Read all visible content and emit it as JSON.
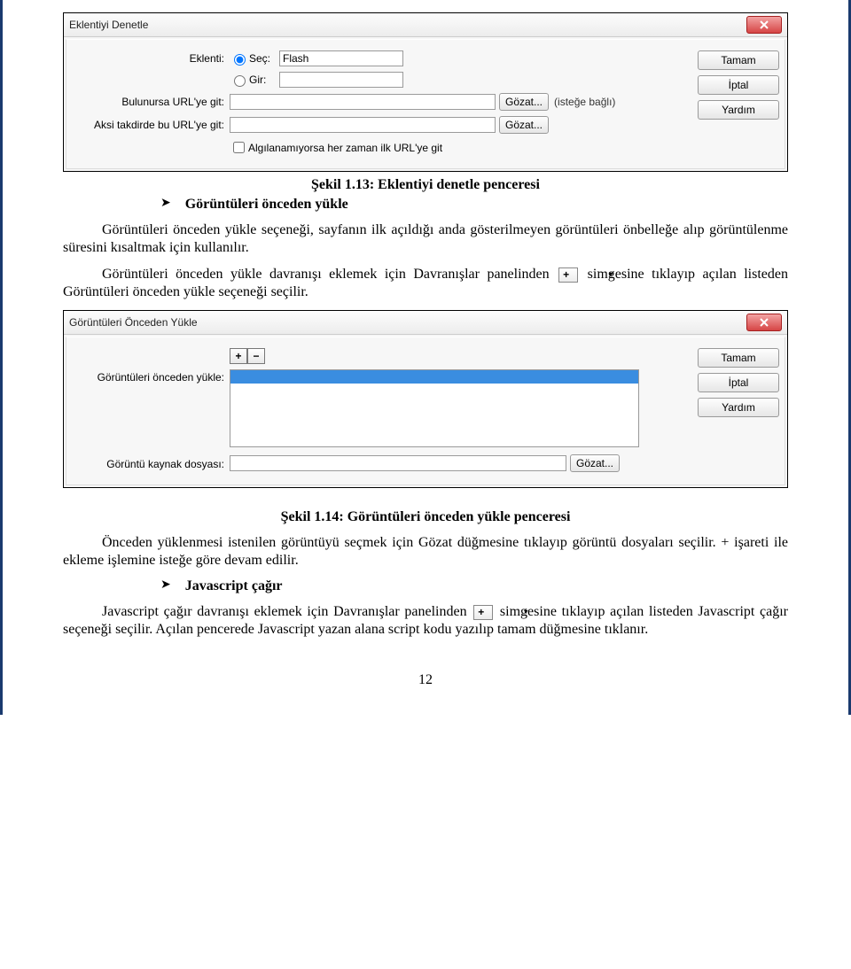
{
  "dialog1": {
    "title": "Eklentiyi Denetle",
    "buttons": {
      "ok": "Tamam",
      "cancel": "İptal",
      "help": "Yardım"
    },
    "labels": {
      "eklenti": "Eklenti:",
      "sec": "Seç:",
      "gir": "Gir:",
      "bulunursa": "Bulunursa URL'ye git:",
      "aksi": "Aksi takdirde bu URL'ye git:",
      "gozat": "Gözat...",
      "istege": "(isteğe bağlı)",
      "algila": "Algılanamıyorsa her zaman ilk URL'ye git"
    },
    "values": {
      "sec_value": "Flash"
    }
  },
  "caption1": "Şekil 1.13: Eklentiyi denetle penceresi",
  "bullet1": "Görüntüleri önceden yükle",
  "para1": "Görüntüleri önceden yükle seçeneği, sayfanın ilk açıldığı anda gösterilmeyen görüntüleri önbelleğe alıp görüntülenme süresini kısaltmak için kullanılır.",
  "para2a": "Görüntüleri önceden yükle davranışı eklemek için Davranışlar panelinden ",
  "para2b": " simgesine tıklayıp açılan listeden Görüntüleri önceden yükle seçeneği seçilir.",
  "dialog2": {
    "title": "Görüntüleri Önceden Yükle",
    "buttons": {
      "ok": "Tamam",
      "cancel": "İptal",
      "help": "Yardım"
    },
    "labels": {
      "preload": "Görüntüleri önceden yükle:",
      "source": "Görüntü kaynak dosyası:",
      "gozat": "Gözat..."
    }
  },
  "caption2": "Şekil 1.14: Görüntüleri önceden yükle penceresi",
  "para3": "Önceden yüklenmesi istenilen görüntüyü seçmek için Gözat düğmesine tıklayıp görüntü dosyaları seçilir. + işareti ile ekleme işlemine isteğe göre devam edilir.",
  "bullet2": "Javascript çağır",
  "para4a": "Javascript çağır davranışı eklemek için Davranışlar panelinden ",
  "para4b": "simgesine tıklayıp açılan listeden Javascript çağır seçeneği seçilir. Açılan pencerede Javascript yazan alana script kodu yazılıp tamam düğmesine tıklanır.",
  "pagenum": "12"
}
